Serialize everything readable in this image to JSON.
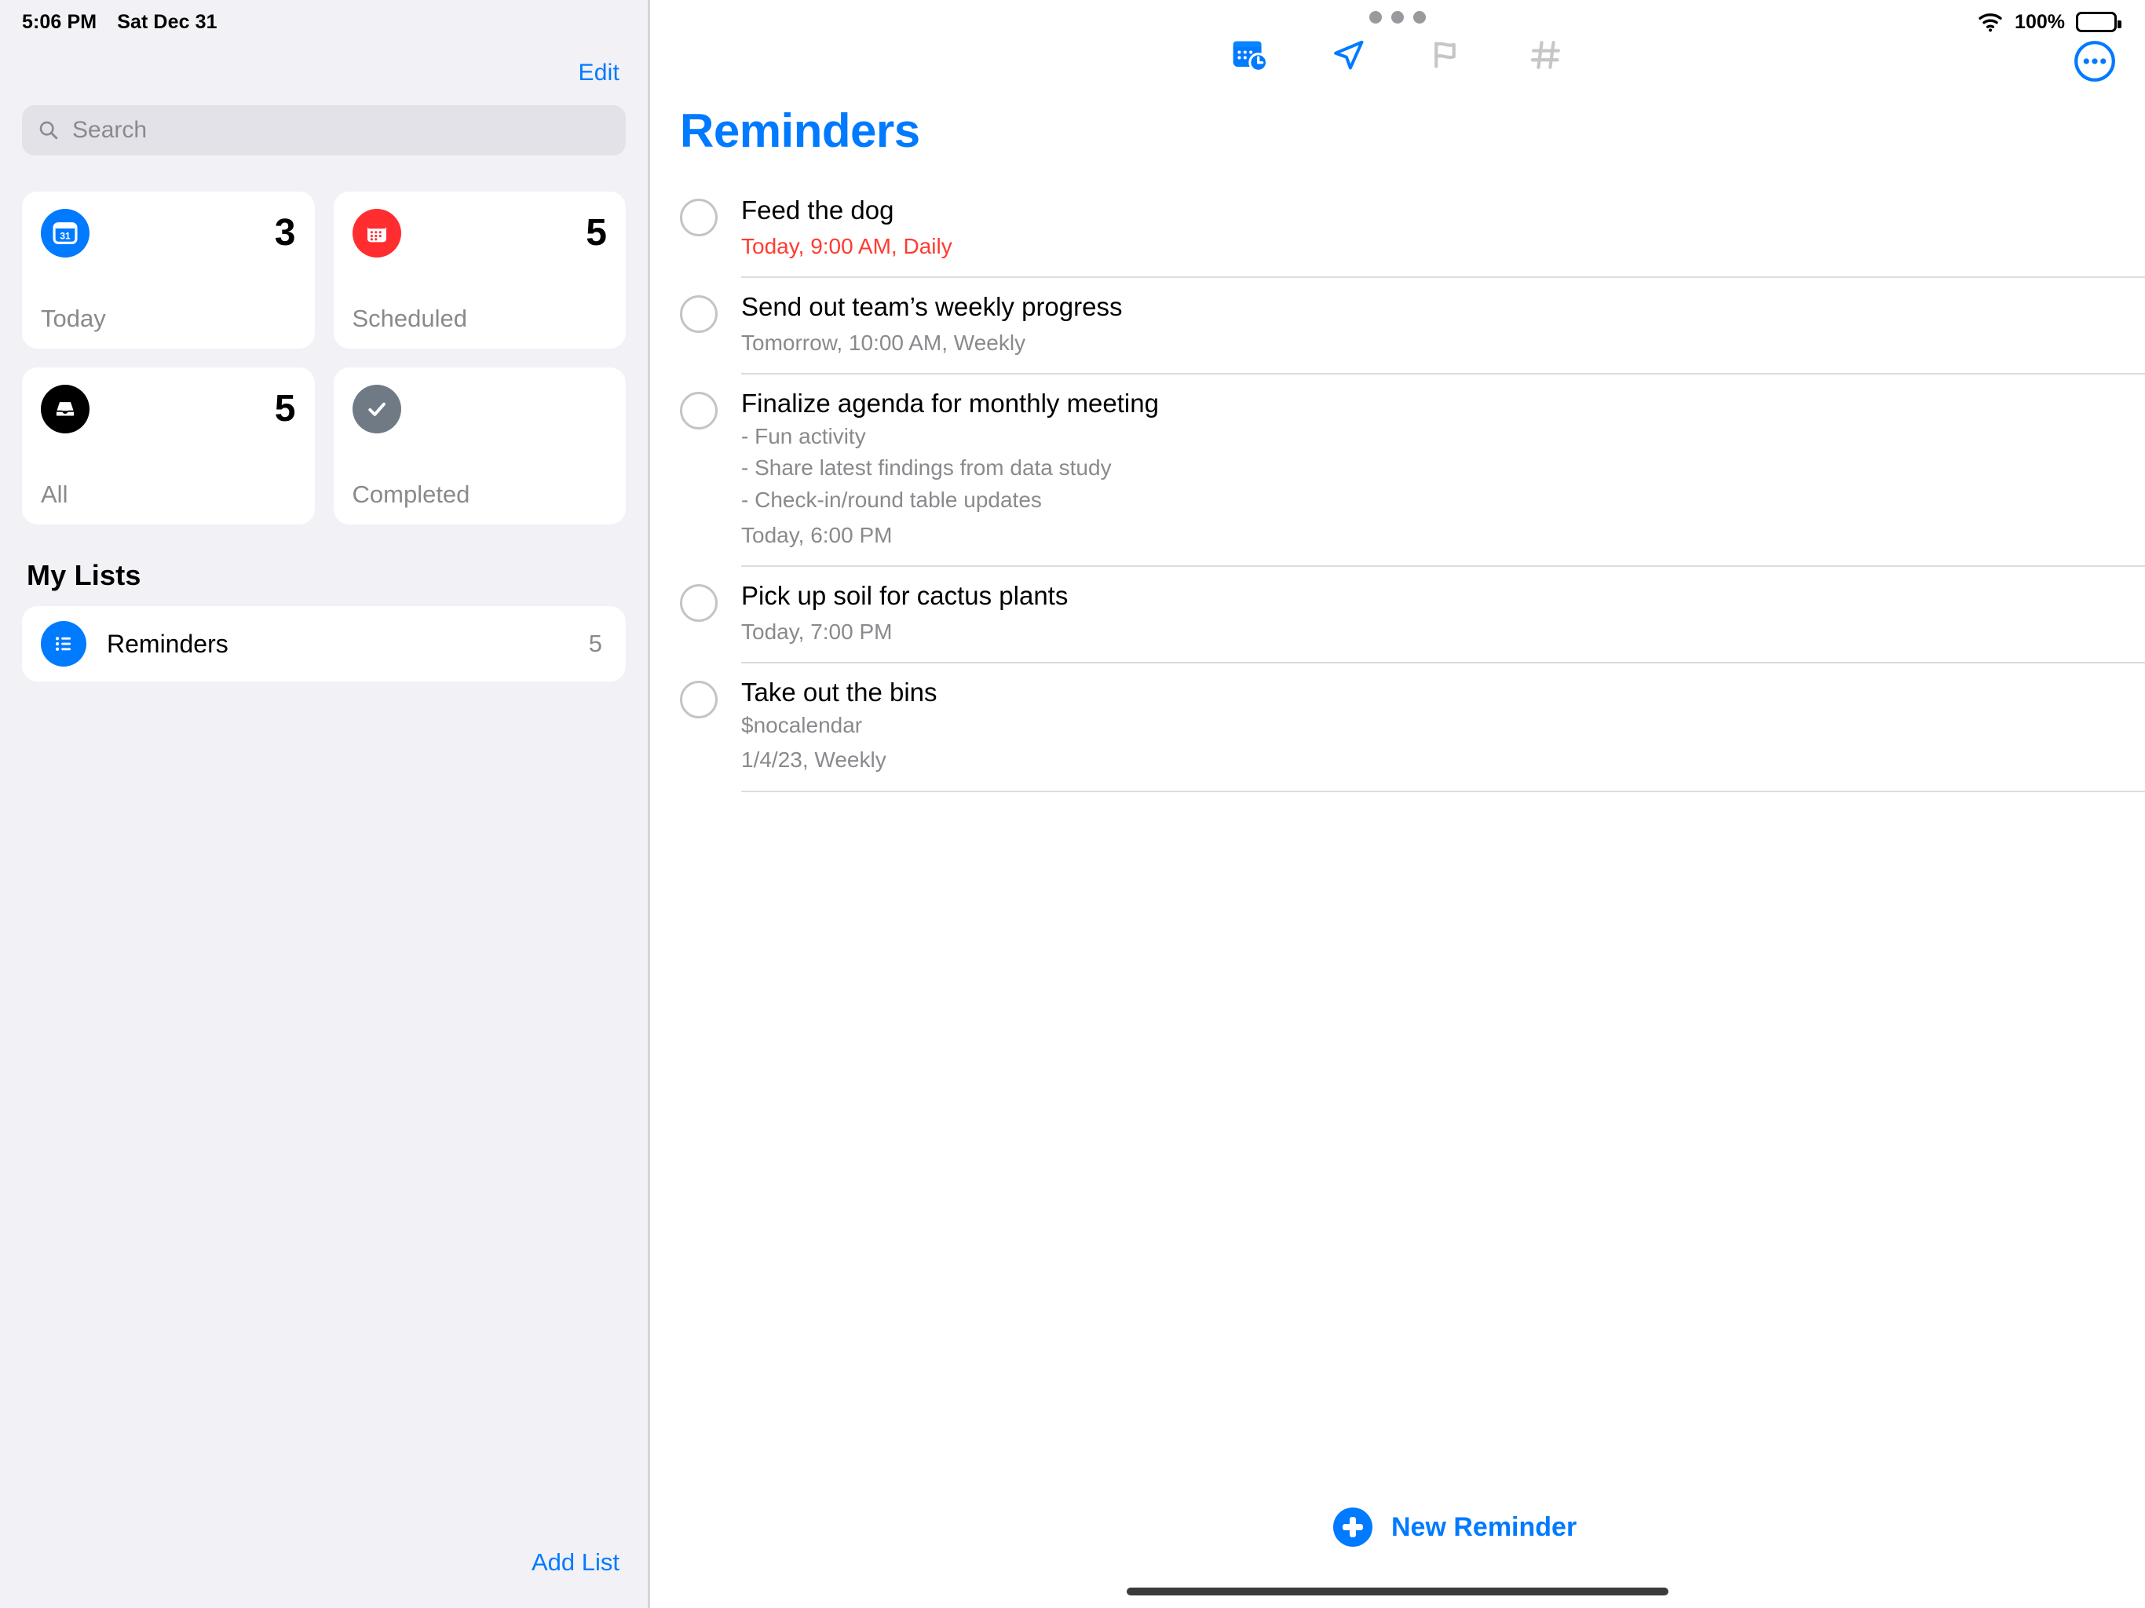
{
  "status_bar": {
    "time": "5:06 PM",
    "date": "Sat Dec 31",
    "battery_percent": "100%",
    "wifi_icon": "wifi-icon",
    "battery_icon": "battery-full-icon"
  },
  "sidebar": {
    "edit_label": "Edit",
    "search": {
      "placeholder": "Search",
      "value": "",
      "icon": "search-icon"
    },
    "smart_lists": [
      {
        "label": "Today",
        "count": "3",
        "icon": "calendar-day-icon",
        "color": "#007AFF"
      },
      {
        "label": "Scheduled",
        "count": "5",
        "icon": "calendar-icon",
        "color": "#FF2D2F"
      },
      {
        "label": "All",
        "count": "5",
        "icon": "inbox-tray-icon",
        "color": "#000000"
      },
      {
        "label": "Completed",
        "count": "",
        "icon": "checkmark-icon",
        "color": "#6F7A85"
      }
    ],
    "my_lists_header": "My Lists",
    "lists": [
      {
        "name": "Reminders",
        "count": "5",
        "icon": "bulleted-list-icon",
        "color": "#007AFF"
      }
    ],
    "add_list_label": "Add List"
  },
  "detail": {
    "toolbar": [
      {
        "name": "calendar-clock-icon",
        "active": true
      },
      {
        "name": "location-arrow-icon",
        "active": true
      },
      {
        "name": "flag-icon",
        "active": false
      },
      {
        "name": "hashtag-icon",
        "active": false
      }
    ],
    "more_icon": "more-circle-icon",
    "title": "Reminders",
    "title_color": "#007AFF",
    "reminders": [
      {
        "title": "Feed the dog",
        "notes": [],
        "due": "Today, 9:00 AM, Daily",
        "due_overdue": true
      },
      {
        "title": "Send out team’s weekly progress",
        "notes": [],
        "due": "Tomorrow, 10:00 AM, Weekly",
        "due_overdue": false
      },
      {
        "title": "Finalize agenda for monthly meeting",
        "notes": [
          "- Fun activity",
          "- Share latest findings from data study",
          "- Check-in/round table updates"
        ],
        "due": "Today, 6:00 PM",
        "due_overdue": false
      },
      {
        "title": "Pick up soil for cactus plants",
        "notes": [],
        "due": "Today, 7:00 PM",
        "due_overdue": false
      },
      {
        "title": "Take out the bins",
        "notes": [
          "$nocalendar"
        ],
        "due": "1/4/23, Weekly",
        "due_overdue": false
      }
    ],
    "new_reminder_label": "New Reminder",
    "new_reminder_icon": "plus-circle-icon"
  }
}
